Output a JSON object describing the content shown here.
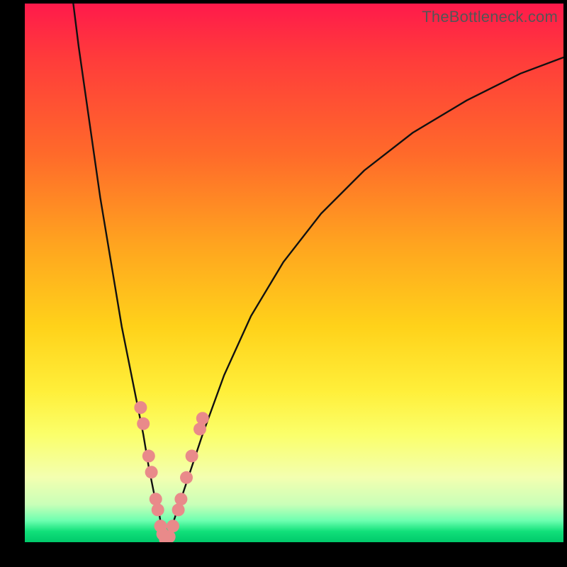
{
  "watermark": "TheBottleneck.com",
  "chart_data": {
    "type": "line",
    "title": "",
    "xlabel": "",
    "ylabel": "",
    "xlim": [
      0,
      100
    ],
    "ylim": [
      0,
      100
    ],
    "legend": false,
    "grid": false,
    "series": [
      {
        "name": "left-branch",
        "x": [
          9,
          10,
          12,
          14,
          16,
          18,
          20,
          22,
          23,
          24,
          25,
          25.5,
          26
        ],
        "y": [
          100,
          92,
          78,
          64,
          52,
          40,
          30,
          20,
          14,
          9,
          5,
          2,
          0
        ]
      },
      {
        "name": "right-branch",
        "x": [
          26,
          27,
          28,
          30,
          33,
          37,
          42,
          48,
          55,
          63,
          72,
          82,
          92,
          100
        ],
        "y": [
          0,
          2,
          5,
          11,
          20,
          31,
          42,
          52,
          61,
          69,
          76,
          82,
          87,
          90
        ]
      }
    ],
    "markers": {
      "name": "highlight-points",
      "color": "#e98a8a",
      "radius_px": 9,
      "points": [
        {
          "x": 21.5,
          "y": 25
        },
        {
          "x": 22,
          "y": 22
        },
        {
          "x": 23,
          "y": 16
        },
        {
          "x": 23.5,
          "y": 13
        },
        {
          "x": 24.3,
          "y": 8
        },
        {
          "x": 24.7,
          "y": 6
        },
        {
          "x": 25.2,
          "y": 3
        },
        {
          "x": 25.6,
          "y": 1.5
        },
        {
          "x": 26.1,
          "y": 0.5
        },
        {
          "x": 26.8,
          "y": 1
        },
        {
          "x": 27.5,
          "y": 3
        },
        {
          "x": 28.5,
          "y": 6
        },
        {
          "x": 29,
          "y": 8
        },
        {
          "x": 30,
          "y": 12
        },
        {
          "x": 31,
          "y": 16
        },
        {
          "x": 32.5,
          "y": 21
        },
        {
          "x": 33,
          "y": 23
        }
      ]
    }
  }
}
